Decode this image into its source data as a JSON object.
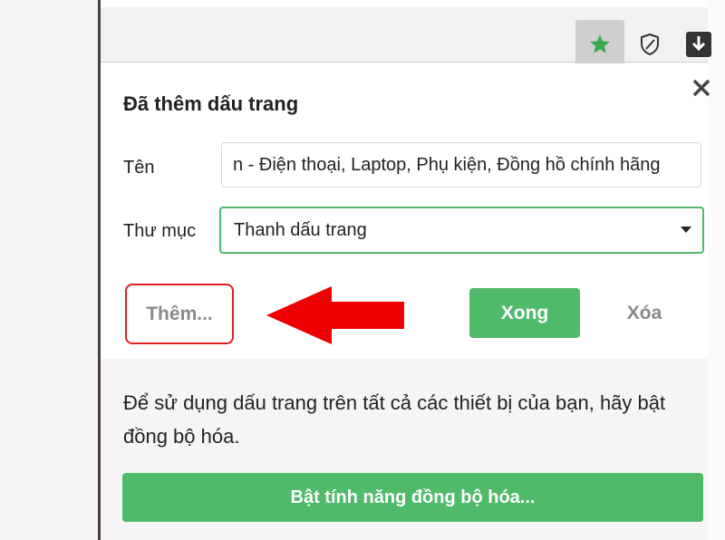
{
  "toolbar": {
    "icons": [
      "star-icon",
      "shield-icon",
      "download-icon"
    ]
  },
  "dialog": {
    "title": "Đã thêm dấu trang",
    "name_label": "Tên",
    "name_value": "n - Điện thoại, Laptop, Phụ kiện, Đồng hồ chính hãng",
    "folder_label": "Thư mục",
    "folder_value": "Thanh dấu trang",
    "more_button": "Thêm...",
    "done_button": "Xong",
    "delete_button": "Xóa",
    "sync_message": "Để sử dụng dấu trang trên tất cả các thiết bị của bạn, hãy bật đồng bộ hóa.",
    "sync_button": "Bật tính năng đồng bộ hóa..."
  },
  "colors": {
    "accent_green": "#4fba6a",
    "highlight_red": "#e02020"
  }
}
